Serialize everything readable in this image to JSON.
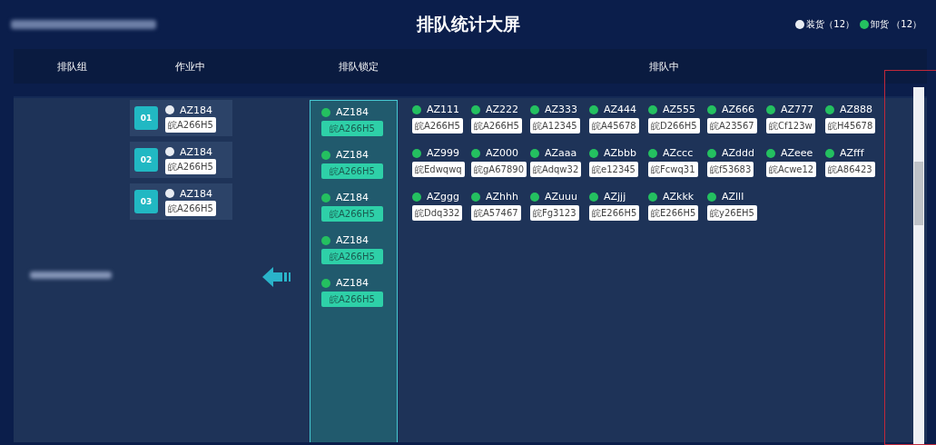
{
  "header": {
    "title": "排队统计大屏",
    "legend": [
      {
        "label": "装货（12）",
        "done": false
      },
      {
        "label": "卸货 （12）",
        "done": true
      }
    ]
  },
  "columns": [
    "排队组",
    "作业中",
    "排队锁定",
    "排队中"
  ],
  "working": [
    {
      "index": "01",
      "code": "AZ184",
      "plate": "皖A266H5",
      "done": false
    },
    {
      "index": "02",
      "code": "AZ184",
      "plate": "皖A266H5",
      "done": false
    },
    {
      "index": "03",
      "code": "AZ184",
      "plate": "皖A266H5",
      "done": false
    }
  ],
  "locked": [
    {
      "code": "AZ184",
      "plate": "皖A266H5",
      "done": true
    },
    {
      "code": "AZ184",
      "plate": "皖A266H5",
      "done": true
    },
    {
      "code": "AZ184",
      "plate": "皖A266H5",
      "done": true
    },
    {
      "code": "AZ184",
      "plate": "皖A266H5",
      "done": true
    },
    {
      "code": "AZ184",
      "plate": "皖A266H5",
      "done": true
    }
  ],
  "queue": [
    {
      "code": "AZ111",
      "plate": "皖A266H5",
      "done": true
    },
    {
      "code": "AZ222",
      "plate": "皖A266H5",
      "done": true
    },
    {
      "code": "AZ333",
      "plate": "皖A12345",
      "done": true
    },
    {
      "code": "AZ444",
      "plate": "皖A45678",
      "done": true
    },
    {
      "code": "AZ555",
      "plate": "皖D266H5",
      "done": true
    },
    {
      "code": "AZ666",
      "plate": "皖A23567",
      "done": true
    },
    {
      "code": "AZ777",
      "plate": "皖Cf123w",
      "done": true
    },
    {
      "code": "AZ888",
      "plate": "皖H45678",
      "done": true
    },
    {
      "code": "AZ999",
      "plate": "皖Edwqwq",
      "done": true
    },
    {
      "code": "AZ000",
      "plate": "皖gA67890",
      "done": true
    },
    {
      "code": "AZaaa",
      "plate": "皖Adqw32",
      "done": true
    },
    {
      "code": "AZbbb",
      "plate": "皖e12345",
      "done": true
    },
    {
      "code": "AZccc",
      "plate": "皖Fcwq31",
      "done": true
    },
    {
      "code": "AZddd",
      "plate": "皖f53683",
      "done": true
    },
    {
      "code": "AZeee",
      "plate": "皖Acwe12",
      "done": true
    },
    {
      "code": "AZfff",
      "plate": "皖A86423",
      "done": true
    },
    {
      "code": "AZggg",
      "plate": "皖Ddq332",
      "done": true
    },
    {
      "code": "AZhhh",
      "plate": "皖A57467",
      "done": true
    },
    {
      "code": "AZuuu",
      "plate": "皖Fg3123",
      "done": true
    },
    {
      "code": "AZjjj",
      "plate": "皖E266H5",
      "done": true
    },
    {
      "code": "AZkkk",
      "plate": "皖E266H5",
      "done": true
    },
    {
      "code": "AZlll",
      "plate": "皖y26EH5",
      "done": true
    }
  ]
}
